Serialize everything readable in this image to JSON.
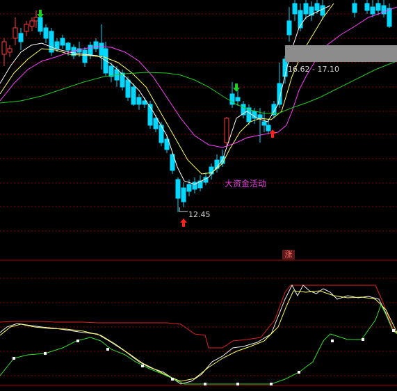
{
  "labels": {
    "low_price": "12.45",
    "price_range": "16.62 - 17.10",
    "activity_note": "大资金活动",
    "indicator_badge": "涨"
  },
  "colors": {
    "background": "#000000",
    "grid": "#8b0000",
    "candle_up": "#ff3b3b",
    "candle_down": "#00d8ff",
    "ma_short": "#ffffff",
    "ma_mid": "#ffff66",
    "ma_long": "#ff40ff",
    "ma_longest": "#22cc22",
    "arrow_buy": "#ff2020",
    "arrow_sell": "#20d020",
    "activity_text": "#e040e0"
  },
  "signals": {
    "buy_arrow_icon": "red-up-arrow-icon",
    "sell_arrow_icon": "green-down-arrow-icon"
  }
}
